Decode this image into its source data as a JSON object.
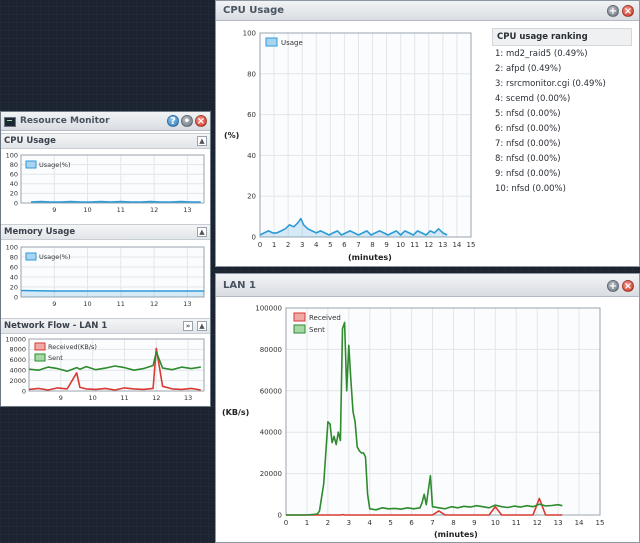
{
  "rm": {
    "title": "Resource Monitor",
    "cpu": {
      "header": "CPU Usage",
      "legend": "Usage(%)"
    },
    "mem": {
      "header": "Memory Usage",
      "legend": "Usage(%)"
    },
    "net": {
      "header": "Network Flow - LAN 1",
      "legend_received": "Received(KB/s)",
      "legend_sent": "Sent"
    }
  },
  "cpuwin": {
    "title": "CPU Usage",
    "ylabel": "(%)",
    "xlabel": "(minutes)",
    "legend": "Usage",
    "ranking_title": "CPU usage ranking",
    "ranking": [
      "1: md2_raid5 (0.49%)",
      "2: afpd (0.49%)",
      "3: rsrcmonitor.cgi (0.49%)",
      "4: scemd (0.00%)",
      "5: nfsd (0.00%)",
      "6: nfsd (0.00%)",
      "7: nfsd (0.00%)",
      "8: nfsd (0.00%)",
      "9: nfsd (0.00%)",
      "10: nfsd (0.00%)"
    ]
  },
  "lanwin": {
    "title": "LAN 1",
    "ylabel": "(KB/s)",
    "xlabel": "(minutes)",
    "legend_received": "Received",
    "legend_sent": "Sent"
  },
  "colors": {
    "cpu": "#2e9ad6",
    "received": "#d83a32",
    "sent": "#2e8b2e"
  },
  "chart_data": [
    {
      "id": "rm_cpu",
      "type": "area",
      "x": [
        8.3,
        8.6,
        8.9,
        9.2,
        9.5,
        9.8,
        10.1,
        10.4,
        10.7,
        11.0,
        11.3,
        11.6,
        11.9,
        12.2,
        12.5,
        12.8,
        13.1,
        13.4
      ],
      "series": [
        {
          "name": "Usage(%)",
          "values": [
            2,
            3,
            2,
            2,
            3,
            2,
            2,
            3,
            2,
            3,
            2,
            2,
            3,
            2,
            2,
            3,
            2,
            2
          ]
        }
      ],
      "xlim": [
        8,
        13.5
      ],
      "ylim": [
        0,
        100
      ],
      "xticks": [
        "9",
        "10",
        "11",
        "12",
        "13"
      ],
      "yticks": [
        "0",
        "20",
        "40",
        "60",
        "80",
        "100"
      ]
    },
    {
      "id": "rm_mem",
      "type": "area",
      "x": [
        8.0,
        9.0,
        10.0,
        11.0,
        12.0,
        13.0,
        13.5
      ],
      "series": [
        {
          "name": "Usage(%)",
          "values": [
            13,
            12,
            12,
            12,
            12,
            12,
            12
          ]
        }
      ],
      "xlim": [
        8,
        13.5
      ],
      "ylim": [
        0,
        100
      ],
      "xticks": [
        "9",
        "10",
        "11",
        "12",
        "13"
      ],
      "yticks": [
        "0",
        "20",
        "40",
        "60",
        "80",
        "100"
      ]
    },
    {
      "id": "rm_net",
      "type": "line",
      "x": [
        8.0,
        8.3,
        8.6,
        8.9,
        9.2,
        9.5,
        9.6,
        9.8,
        10.1,
        10.4,
        10.7,
        11.0,
        11.3,
        11.6,
        11.9,
        12.0,
        12.2,
        12.5,
        12.8,
        13.1,
        13.4
      ],
      "series": [
        {
          "name": "Received(KB/s)",
          "values": [
            300,
            500,
            200,
            600,
            400,
            3500,
            700,
            400,
            300,
            500,
            200,
            600,
            400,
            300,
            500,
            8200,
            900,
            400,
            300,
            500,
            200
          ]
        },
        {
          "name": "Sent",
          "values": [
            4200,
            4000,
            4600,
            4300,
            3800,
            4500,
            4200,
            4700,
            4100,
            4400,
            4800,
            4500,
            4000,
            4300,
            4900,
            7500,
            4400,
            4100,
            4600,
            4300,
            4600
          ]
        }
      ],
      "xlim": [
        8,
        13.5
      ],
      "ylim": [
        0,
        10000
      ],
      "xticks": [
        "9",
        "10",
        "11",
        "12",
        "13"
      ],
      "yticks": [
        "0",
        "2000",
        "4000",
        "6000",
        "8000",
        "10000"
      ]
    },
    {
      "id": "cpu_big",
      "type": "area",
      "x": [
        0.0,
        0.3,
        0.6,
        0.9,
        1.2,
        1.5,
        1.8,
        2.1,
        2.4,
        2.7,
        2.9,
        3.1,
        3.4,
        3.7,
        4.0,
        4.3,
        4.6,
        4.9,
        5.2,
        5.5,
        5.8,
        6.1,
        6.4,
        6.7,
        7.0,
        7.3,
        7.6,
        7.9,
        8.2,
        8.5,
        8.8,
        9.1,
        9.4,
        9.7,
        10.0,
        10.3,
        10.6,
        10.9,
        11.2,
        11.5,
        11.8,
        12.1,
        12.4,
        12.7,
        13.0,
        13.3
      ],
      "series": [
        {
          "name": "Usage",
          "values": [
            1,
            2,
            3,
            2,
            2,
            3,
            4,
            6,
            5,
            7,
            9,
            6,
            4,
            3,
            2,
            3,
            2,
            1,
            2,
            3,
            1,
            2,
            3,
            2,
            1,
            2,
            3,
            1,
            2,
            3,
            2,
            1,
            2,
            3,
            1,
            3,
            2,
            1,
            3,
            2,
            1,
            3,
            2,
            4,
            2,
            1
          ]
        }
      ],
      "xlim": [
        0,
        15
      ],
      "ylim": [
        0,
        100
      ],
      "xticks": [
        "0",
        "1",
        "2",
        "3",
        "4",
        "5",
        "6",
        "7",
        "8",
        "9",
        "10",
        "11",
        "12",
        "13",
        "14",
        "15"
      ],
      "yticks": [
        "0",
        "20",
        "40",
        "60",
        "80",
        "100"
      ]
    },
    {
      "id": "lan_big",
      "type": "line",
      "x": [
        0.0,
        0.5,
        1.0,
        1.5,
        1.6,
        1.8,
        2.0,
        2.1,
        2.2,
        2.3,
        2.4,
        2.5,
        2.6,
        2.7,
        2.8,
        2.9,
        3.0,
        3.1,
        3.2,
        3.3,
        3.4,
        3.5,
        3.6,
        3.7,
        3.8,
        3.9,
        4.0,
        4.3,
        4.6,
        4.9,
        5.2,
        5.5,
        5.8,
        6.1,
        6.4,
        6.5,
        6.6,
        6.7,
        6.8,
        6.9,
        7.0,
        7.3,
        7.6,
        7.9,
        8.2,
        8.5,
        8.8,
        9.1,
        9.4,
        9.7,
        10.0,
        10.3,
        10.6,
        10.9,
        11.2,
        11.5,
        11.8,
        12.1,
        12.4,
        12.7,
        13.0,
        13.2
      ],
      "series": [
        {
          "name": "Received",
          "values": [
            0,
            0,
            0,
            0,
            0,
            0,
            0,
            0,
            0,
            0,
            0,
            0,
            0,
            200,
            0,
            0,
            0,
            0,
            0,
            0,
            0,
            0,
            0,
            0,
            0,
            0,
            0,
            0,
            0,
            0,
            0,
            0,
            0,
            0,
            0,
            0,
            0,
            0,
            0,
            0,
            0,
            2000,
            0,
            0,
            0,
            0,
            0,
            0,
            0,
            0,
            4000,
            0,
            0,
            0,
            0,
            0,
            0,
            8000,
            0,
            0,
            0,
            0
          ]
        },
        {
          "name": "Sent",
          "values": [
            0,
            0,
            0,
            500,
            2000,
            15000,
            45000,
            44000,
            35000,
            38000,
            34000,
            40000,
            36000,
            90000,
            93000,
            60000,
            82000,
            65000,
            50000,
            45000,
            33000,
            31000,
            30000,
            30000,
            28000,
            10000,
            3000,
            2500,
            3500,
            3000,
            3200,
            2800,
            3500,
            3000,
            3500,
            6000,
            10000,
            5000,
            12000,
            19000,
            4000,
            3500,
            3000,
            4000,
            3500,
            4200,
            3800,
            4500,
            4000,
            3500,
            4800,
            4000,
            3600,
            4300,
            3800,
            4500,
            4000,
            5200,
            4400,
            4600,
            5000,
            4500
          ]
        }
      ],
      "xlim": [
        0,
        15
      ],
      "ylim": [
        0,
        100000
      ],
      "xticks": [
        "0",
        "1",
        "2",
        "3",
        "4",
        "5",
        "6",
        "7",
        "8",
        "9",
        "10",
        "11",
        "12",
        "13",
        "14",
        "15"
      ],
      "yticks": [
        "0",
        "20000",
        "40000",
        "60000",
        "80000",
        "100000"
      ]
    }
  ]
}
